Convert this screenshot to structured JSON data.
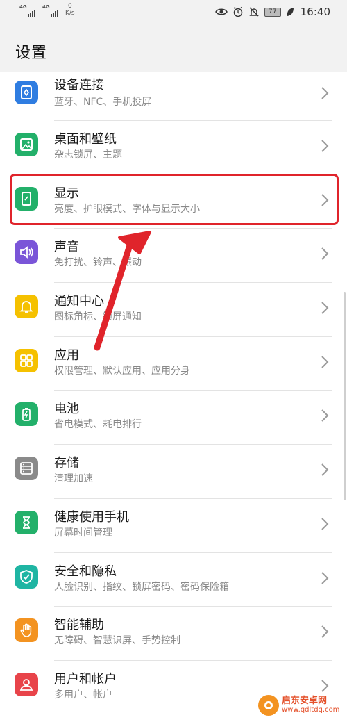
{
  "status_bar": {
    "sim1": "4G",
    "sim2": "4G",
    "net_speed_value": "0",
    "net_speed_unit": "K/s",
    "battery": "77",
    "time": "16:40"
  },
  "header": {
    "title": "设置"
  },
  "items": [
    {
      "title": "设备连接",
      "subtitle": "蓝牙、NFC、手机投屏",
      "color": "#2f7de1",
      "icon": "device-connect-icon"
    },
    {
      "title": "桌面和壁纸",
      "subtitle": "杂志锁屏、主题",
      "color": "#23b06a",
      "icon": "wallpaper-icon"
    },
    {
      "title": "显示",
      "subtitle": "亮度、护眼模式、字体与显示大小",
      "color": "#23b06a",
      "icon": "display-icon"
    },
    {
      "title": "声音",
      "subtitle": "免打扰、铃声、振动",
      "color": "#7a55d8",
      "icon": "sound-icon"
    },
    {
      "title": "通知中心",
      "subtitle": "图标角标、锁屏通知",
      "color": "#f5c100",
      "icon": "bell-icon"
    },
    {
      "title": "应用",
      "subtitle": "权限管理、默认应用、应用分身",
      "color": "#f5c100",
      "icon": "apps-grid-icon"
    },
    {
      "title": "电池",
      "subtitle": "省电模式、耗电排行",
      "color": "#23b06a",
      "icon": "battery-icon"
    },
    {
      "title": "存储",
      "subtitle": "清理加速",
      "color": "#8a8a8a",
      "icon": "storage-icon"
    },
    {
      "title": "健康使用手机",
      "subtitle": "屏幕时间管理",
      "color": "#23b06a",
      "icon": "hourglass-icon"
    },
    {
      "title": "安全和隐私",
      "subtitle": "人脸识别、指纹、锁屏密码、密码保险箱",
      "color": "#1fb5a3",
      "icon": "shield-icon"
    },
    {
      "title": "智能辅助",
      "subtitle": "无障碍、智慧识屏、手势控制",
      "color": "#f39321",
      "icon": "hand-icon"
    },
    {
      "title": "用户和帐户",
      "subtitle": "多用户、帐户",
      "color": "#e8444a",
      "icon": "user-icon"
    }
  ],
  "watermark": {
    "title": "启东安卓网",
    "url": "www.qdltdq.com"
  },
  "colors": {
    "highlight": "#e0242b",
    "header_bg": "#f2f2f2"
  }
}
